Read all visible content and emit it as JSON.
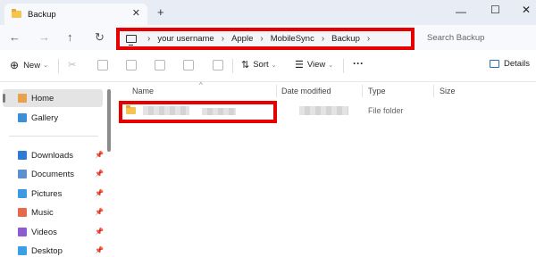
{
  "window": {
    "tab_title": "Backup",
    "tab_close": "✕",
    "new_tab": "+",
    "minimize": "—",
    "maximize": "☐",
    "close": "✕"
  },
  "nav": {
    "back": "←",
    "forward": "→",
    "up": "↑",
    "refresh": "↻"
  },
  "breadcrumb": {
    "separator": "›",
    "items": [
      "your username",
      "Apple",
      "MobileSync",
      "Backup"
    ]
  },
  "search": {
    "placeholder": "Search Backup"
  },
  "toolbar": {
    "new_label": "New",
    "sort_label": "Sort",
    "view_label": "View",
    "more_label": "···",
    "details_label": "Details",
    "chevron": "⌄"
  },
  "sidebar": {
    "items": [
      {
        "label": "Home",
        "icon": "home-icon",
        "color": "#e8a04b"
      },
      {
        "label": "Gallery",
        "icon": "gallery-icon",
        "color": "#3b8fd6"
      },
      {
        "label": "Downloads",
        "icon": "downloads-icon",
        "color": "#2d7bd6"
      },
      {
        "label": "Documents",
        "icon": "documents-icon",
        "color": "#5b8fd0"
      },
      {
        "label": "Pictures",
        "icon": "pictures-icon",
        "color": "#3c9ae0"
      },
      {
        "label": "Music",
        "icon": "music-icon",
        "color": "#e46b4a"
      },
      {
        "label": "Videos",
        "icon": "videos-icon",
        "color": "#8e5cd0"
      },
      {
        "label": "Desktop",
        "icon": "desktop-icon",
        "color": "#3aa0e4"
      }
    ],
    "pin": "📌"
  },
  "columns": {
    "name": "Name",
    "date_modified": "Date modified",
    "type": "Type",
    "size": "Size",
    "sort_caret": "^"
  },
  "files": [
    {
      "type": "File folder"
    }
  ],
  "colors": {
    "highlight": "#e60000",
    "folder": "#f4c452"
  }
}
